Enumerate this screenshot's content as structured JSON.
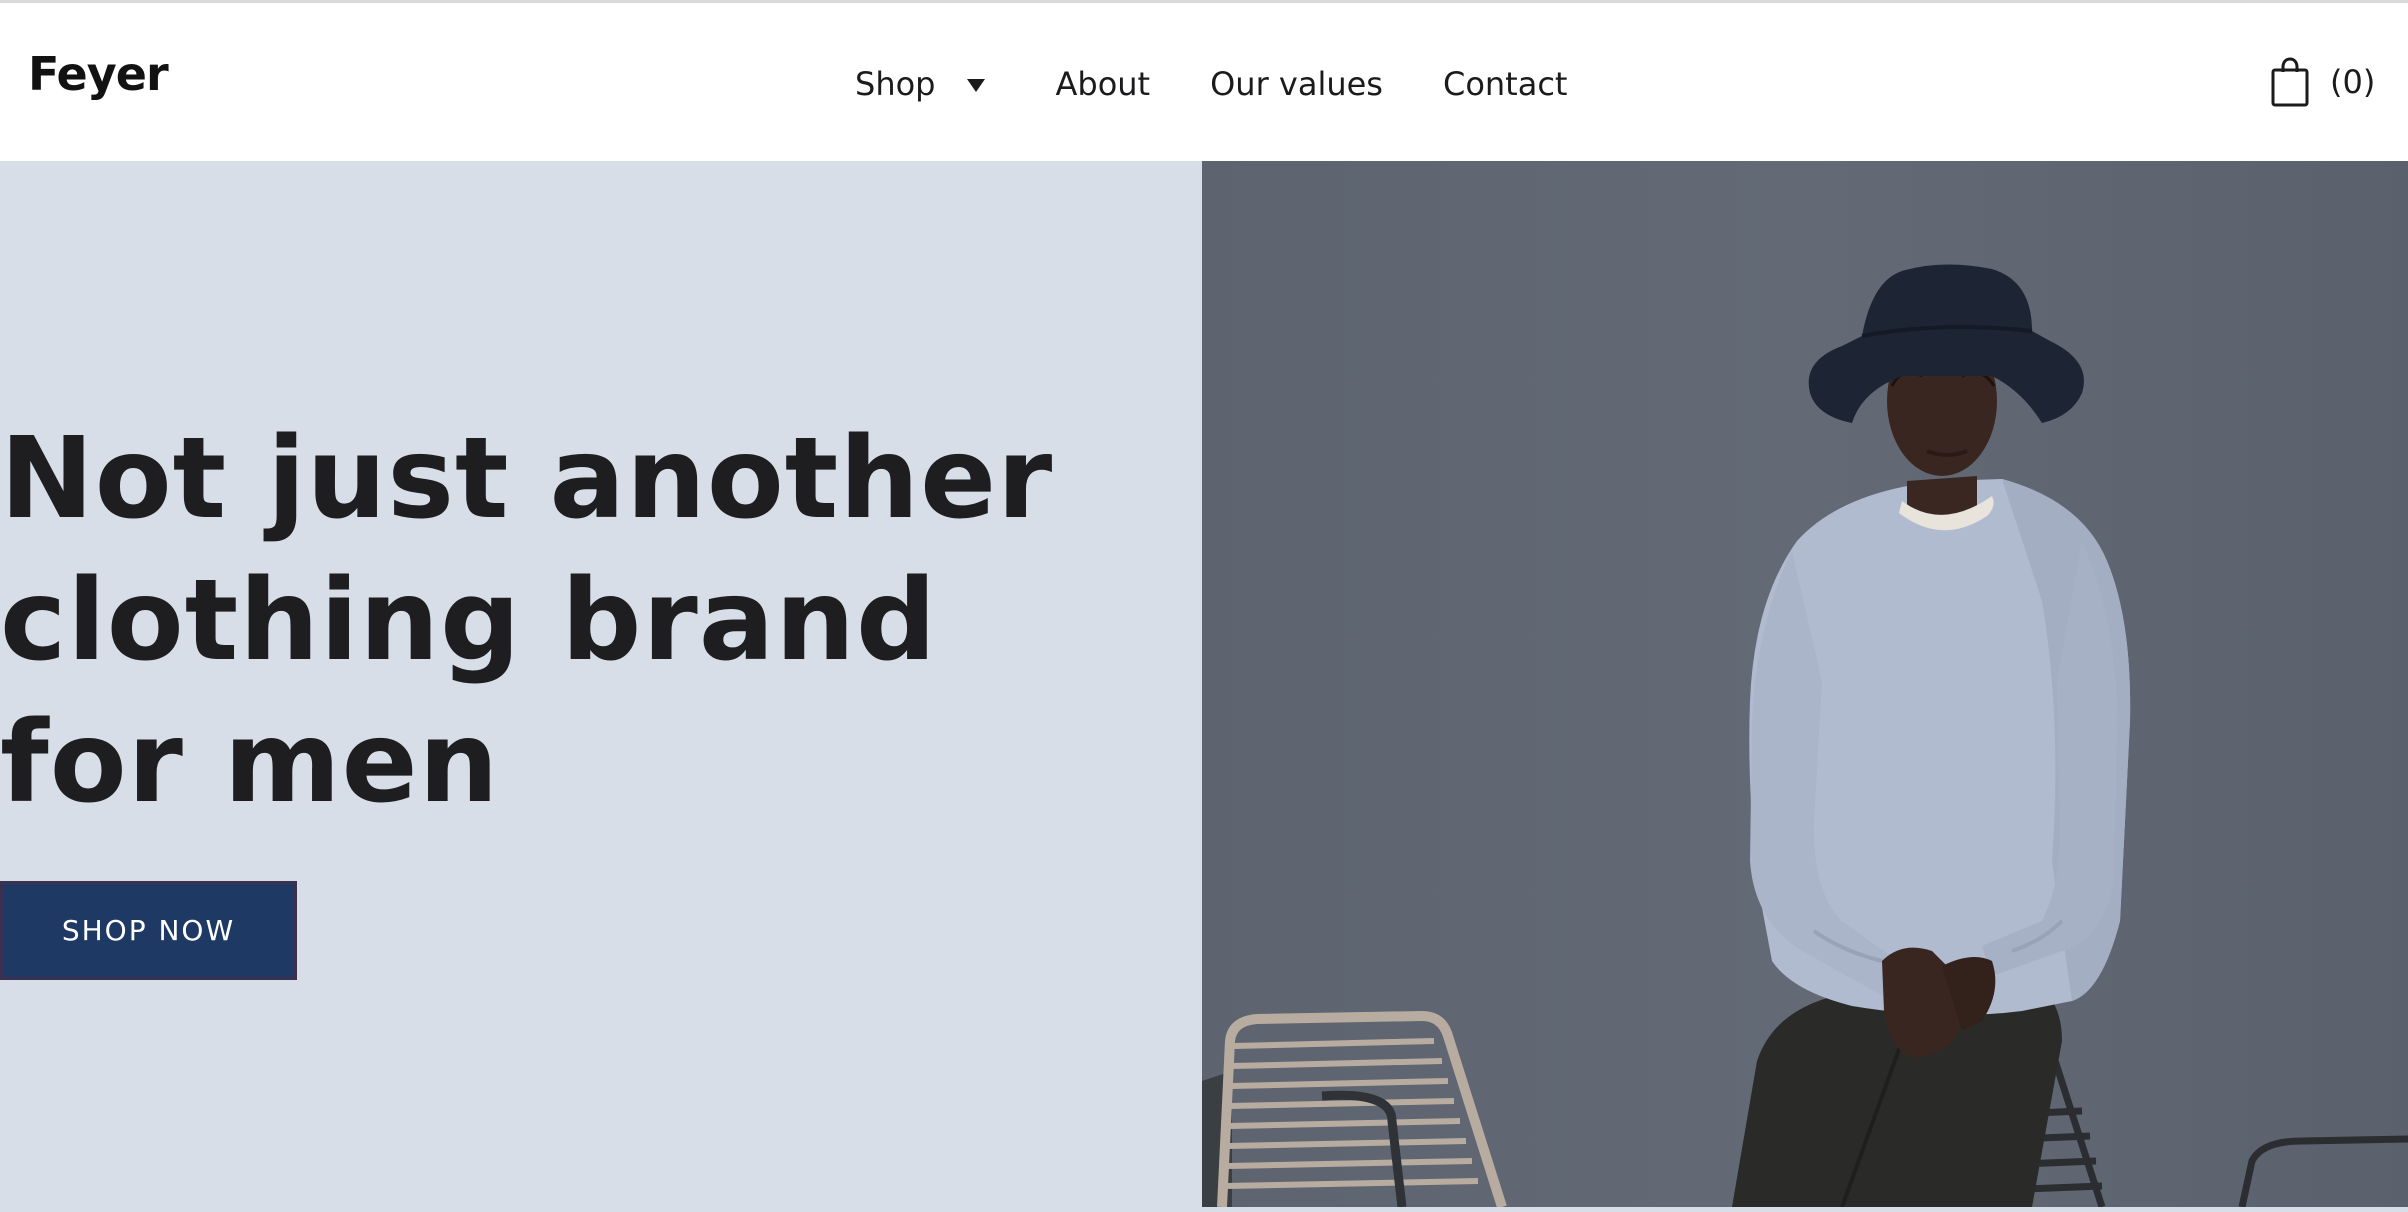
{
  "brand": {
    "name": "Feyer"
  },
  "nav": {
    "items": [
      {
        "label": "Shop",
        "has_dropdown": true
      },
      {
        "label": "About"
      },
      {
        "label": "Our values"
      },
      {
        "label": "Contact"
      }
    ]
  },
  "cart": {
    "icon": "shopping-bag-icon",
    "count_label": "(0)"
  },
  "hero": {
    "title_lines": [
      "Not just another",
      "clothing brand",
      "for men"
    ],
    "cta_label": "SHOP NOW",
    "image_subject": "hero-photo"
  },
  "colors": {
    "hero_left_bg": "#d7dee8",
    "hero_photo_bg": "#5f6672",
    "cta_bg": "#1e3a64",
    "text_dark": "#1b1b1d"
  }
}
